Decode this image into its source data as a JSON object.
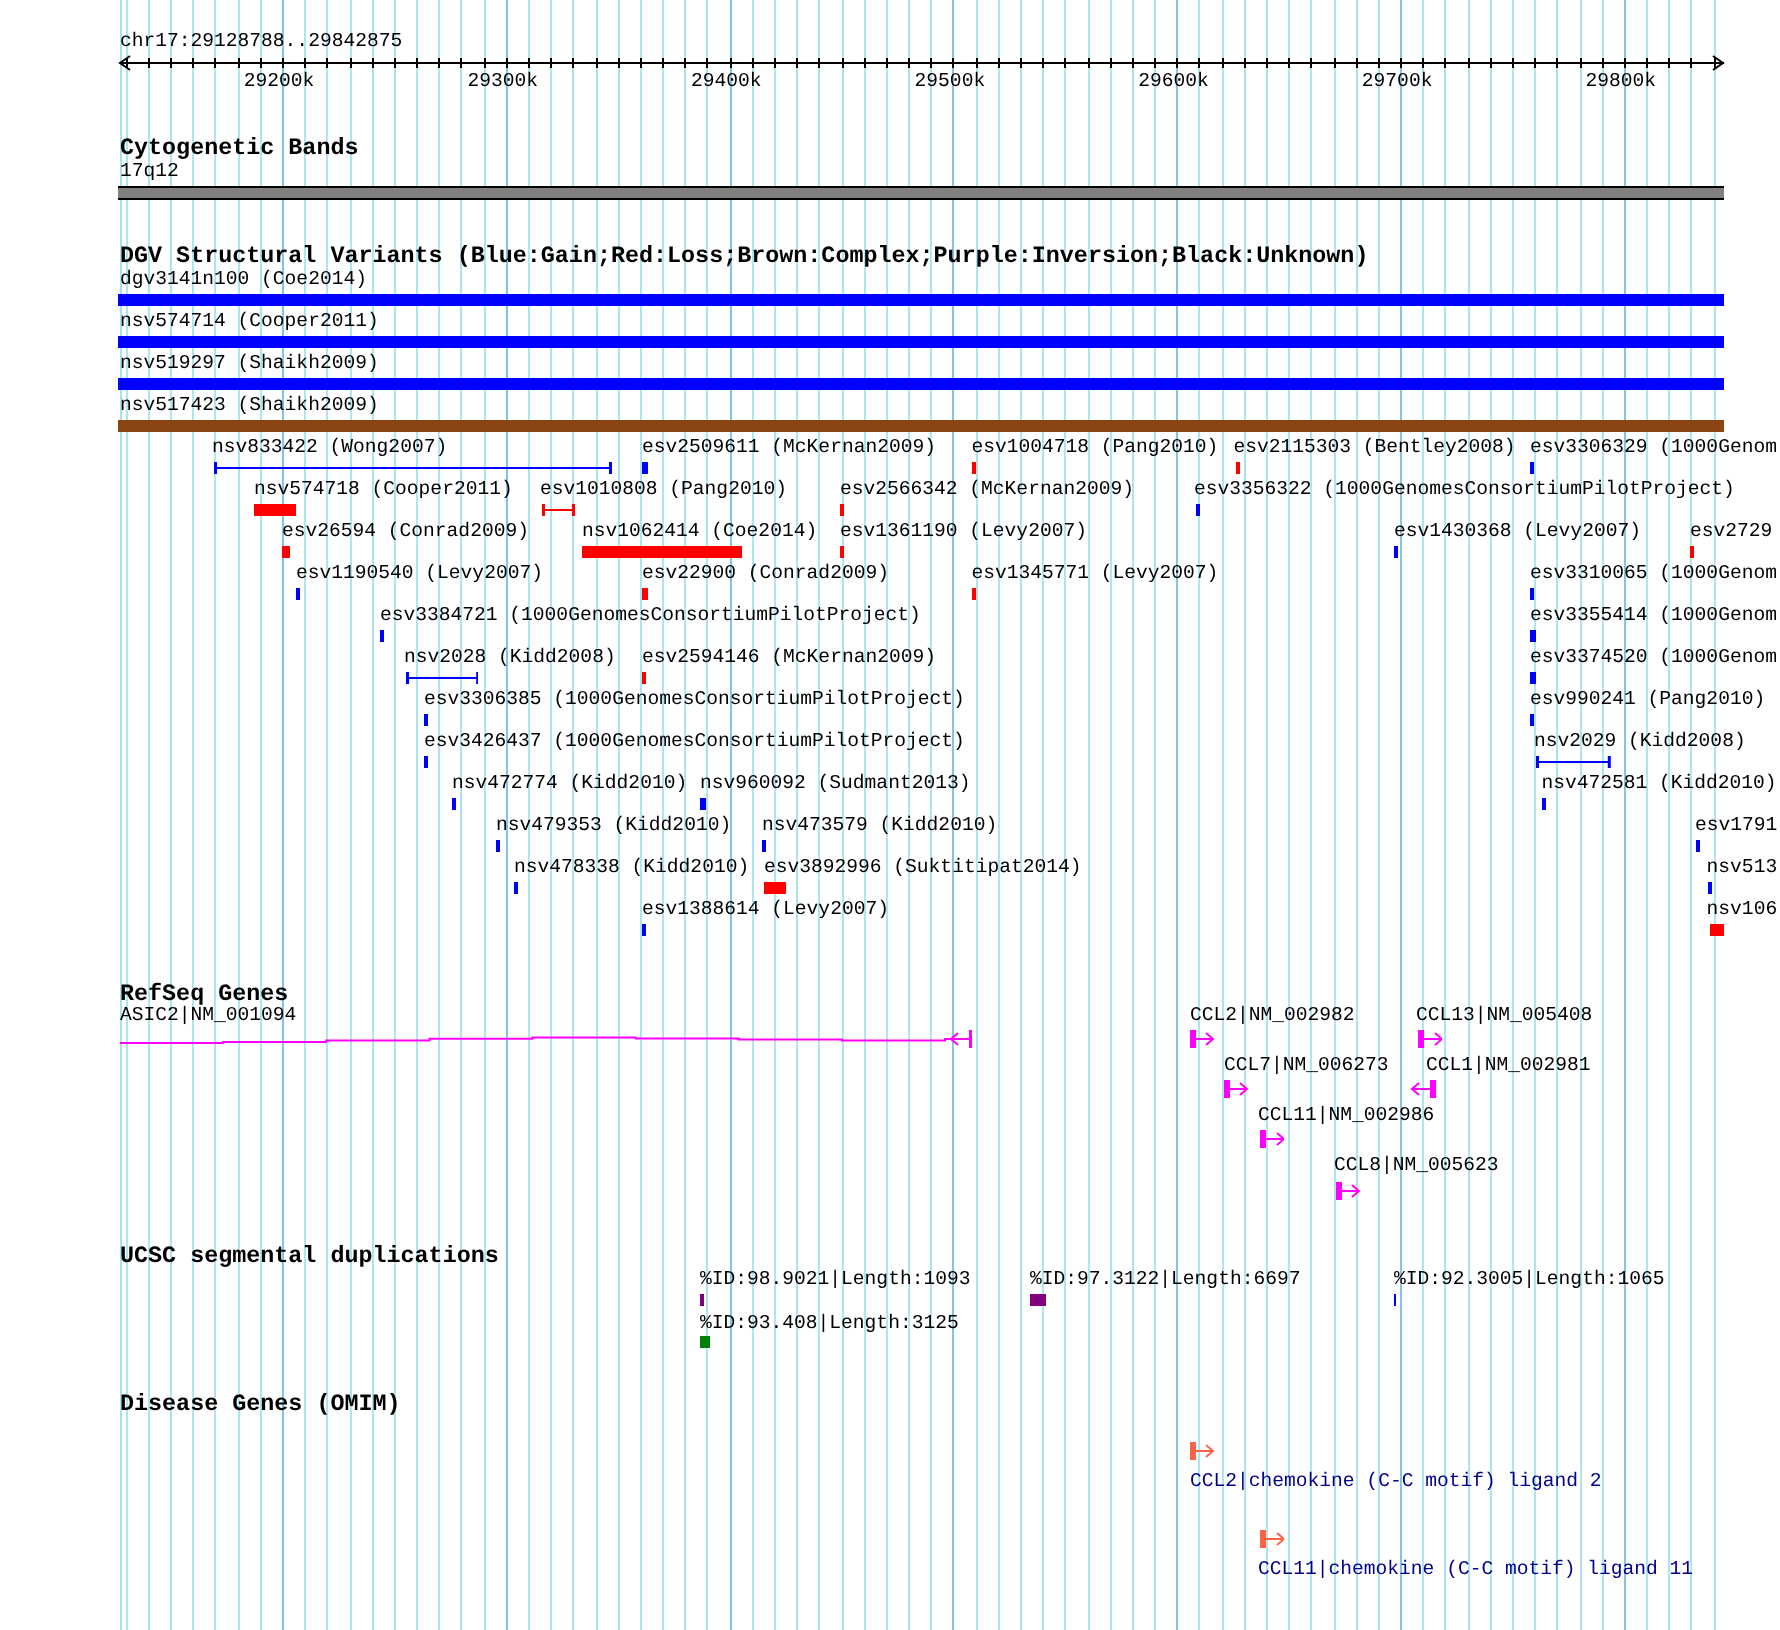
{
  "ruler": {
    "region": "chr17:29128788..29842875",
    "ticks": [
      "29200k",
      "29300k",
      "29400k",
      "29500k",
      "29600k",
      "29700k",
      "29800k"
    ]
  },
  "tracks": [
    {
      "kind": "cytoband",
      "title": "Cytogenetic Bands",
      "bands": [
        {
          "label": "17q12"
        }
      ]
    },
    {
      "kind": "variants",
      "title": "DGV Structural Variants (Blue:Gain;Red:Loss;Brown:Complex;Purple:Inversion;Black:Unknown)",
      "rows": [
        {
          "features": [
            {
              "label": "dgv3141n100 (Coe2014)",
              "kind": "block",
              "color": "#0000ff"
            }
          ]
        },
        {
          "features": [
            {
              "label": "nsv574714 (Cooper2011)",
              "kind": "block",
              "color": "#0000ff"
            }
          ]
        },
        {
          "features": [
            {
              "label": "nsv519297 (Shaikh2009)",
              "kind": "block",
              "color": "#0000ff"
            }
          ]
        },
        {
          "features": [
            {
              "label": "nsv517423 (Shaikh2009)",
              "kind": "block",
              "color": "#8b4513"
            }
          ]
        },
        {
          "features": [
            {
              "label": "nsv833422 (Wong2007)",
              "kind": "interval",
              "color": "#0000ff"
            },
            {
              "label": "esv2509611 (McKernan2009)",
              "kind": "block",
              "color": "#0000ff"
            },
            {
              "label": "esv1004718 (Pang2010)",
              "kind": "block",
              "color": "#ff0000"
            },
            {
              "label": "esv2115303 (Bentley2008)",
              "kind": "block",
              "color": "#ff0000"
            },
            {
              "label": "esv3306329 (1000Genom",
              "kind": "block",
              "color": "#0000ff"
            }
          ]
        },
        {
          "features": [
            {
              "label": "nsv574718 (Cooper2011)",
              "kind": "block",
              "color": "#ff0000"
            },
            {
              "label": "esv1010808 (Pang2010)",
              "kind": "interval",
              "color": "#ff0000"
            },
            {
              "label": "esv2566342 (McKernan2009)",
              "kind": "block",
              "color": "#ff0000"
            },
            {
              "label": "esv3356322 (1000GenomesConsortiumPilotProject)",
              "kind": "block",
              "color": "#0000ff"
            }
          ]
        },
        {
          "features": [
            {
              "label": "esv26594 (Conrad2009)",
              "kind": "block",
              "color": "#ff0000"
            },
            {
              "label": "nsv1062414 (Coe2014)",
              "kind": "block",
              "color": "#ff0000"
            },
            {
              "label": "esv1361190 (Levy2007)",
              "kind": "block",
              "color": "#ff0000"
            },
            {
              "label": "esv1430368 (Levy2007)",
              "kind": "block",
              "color": "#0000ff"
            },
            {
              "label": "esv2729",
              "kind": "block",
              "color": "#ff0000"
            }
          ]
        },
        {
          "features": [
            {
              "label": "esv1190540 (Levy2007)",
              "kind": "block",
              "color": "#0000ff"
            },
            {
              "label": "esv22900 (Conrad2009)",
              "kind": "block",
              "color": "#ff0000"
            },
            {
              "label": "esv1345771 (Levy2007)",
              "kind": "block",
              "color": "#ff0000"
            },
            {
              "label": "esv3310065 (1000Genom",
              "kind": "block",
              "color": "#0000ff"
            }
          ]
        },
        {
          "features": [
            {
              "label": "esv3384721 (1000GenomesConsortiumPilotProject)",
              "kind": "block",
              "color": "#0000ff"
            },
            {
              "label": "esv3355414 (1000Genom",
              "kind": "block",
              "color": "#0000ff"
            }
          ]
        },
        {
          "features": [
            {
              "label": "nsv2028 (Kidd2008)",
              "kind": "interval",
              "color": "#0000ff"
            },
            {
              "label": "esv2594146 (McKernan2009)",
              "kind": "block",
              "color": "#ff0000"
            },
            {
              "label": "esv3374520 (1000Genom",
              "kind": "block",
              "color": "#0000ff"
            }
          ]
        },
        {
          "features": [
            {
              "label": "esv3306385 (1000GenomesConsortiumPilotProject)",
              "kind": "block",
              "color": "#0000ff"
            },
            {
              "label": "esv990241 (Pang2010)",
              "kind": "block",
              "color": "#0000ff"
            }
          ]
        },
        {
          "features": [
            {
              "label": "esv3426437 (1000GenomesConsortiumPilotProject)",
              "kind": "block",
              "color": "#0000ff"
            },
            {
              "label": "nsv2029 (Kidd2008)",
              "kind": "interval",
              "color": "#0000ff"
            }
          ]
        },
        {
          "features": [
            {
              "label": "nsv472774 (Kidd2010)",
              "kind": "block",
              "color": "#0000ff"
            },
            {
              "label": "nsv960092 (Sudmant2013)",
              "kind": "block",
              "color": "#0000ff"
            },
            {
              "label": "nsv472581 (Kidd2010)",
              "kind": "block",
              "color": "#0000ff"
            }
          ]
        },
        {
          "features": [
            {
              "label": "nsv479353 (Kidd2010)",
              "kind": "block",
              "color": "#0000ff"
            },
            {
              "label": "nsv473579 (Kidd2010)",
              "kind": "block",
              "color": "#0000ff"
            },
            {
              "label": "esv1791",
              "kind": "block",
              "color": "#0000ff"
            }
          ]
        },
        {
          "features": [
            {
              "label": "nsv478338 (Kidd2010)",
              "kind": "block",
              "color": "#0000ff"
            },
            {
              "label": "esv3892996 (Suktitipat2014)",
              "kind": "block",
              "color": "#ff0000"
            },
            {
              "label": "nsv513",
              "kind": "block",
              "color": "#0000ff"
            }
          ]
        },
        {
          "features": [
            {
              "label": "esv1388614 (Levy2007)",
              "kind": "block",
              "color": "#0000ff"
            },
            {
              "label": "nsv106",
              "kind": "block",
              "color": "#ff0000"
            }
          ]
        }
      ]
    },
    {
      "kind": "genes",
      "title": "RefSeq Genes",
      "rows": [
        {
          "features": [
            {
              "label": "ASIC2|NM_001094",
              "reverse_strand": true
            },
            {
              "label": "CCL2|NM_002982",
              "reverse_strand": false
            },
            {
              "label": "CCL13|NM_005408",
              "reverse_strand": false
            }
          ]
        },
        {
          "features": [
            {
              "label": "CCL7|NM_006273",
              "reverse_strand": false
            },
            {
              "label": "CCL1|NM_002981",
              "reverse_strand": true
            }
          ]
        },
        {
          "features": [
            {
              "label": "CCL11|NM_002986",
              "reverse_strand": false
            }
          ]
        },
        {
          "features": [
            {
              "label": "CCL8|NM_005623",
              "reverse_strand": false
            }
          ]
        }
      ]
    },
    {
      "kind": "duplications",
      "title": "UCSC segmental duplications",
      "rows": [
        {
          "features": [
            {
              "label": "%ID:98.9021|Length:1093",
              "color": "#800080"
            },
            {
              "label": "%ID:97.3122|Length:6697",
              "color": "#800080"
            },
            {
              "label": "%ID:92.3005|Length:1065",
              "color": "#0000ff"
            }
          ]
        },
        {
          "features": [
            {
              "label": "%ID:93.408|Length:3125",
              "color": "#008000"
            }
          ]
        }
      ]
    },
    {
      "kind": "disease",
      "title": "Disease Genes (OMIM)",
      "rows": [
        {
          "features": [
            {
              "label": "CCL2|chemokine (C-C motif) ligand 2",
              "reverse_strand": false
            }
          ]
        },
        {
          "features": [
            {
              "label": "CCL11|chemokine (C-C motif) ligand 11",
              "reverse_strand": false
            }
          ]
        }
      ]
    }
  ]
}
